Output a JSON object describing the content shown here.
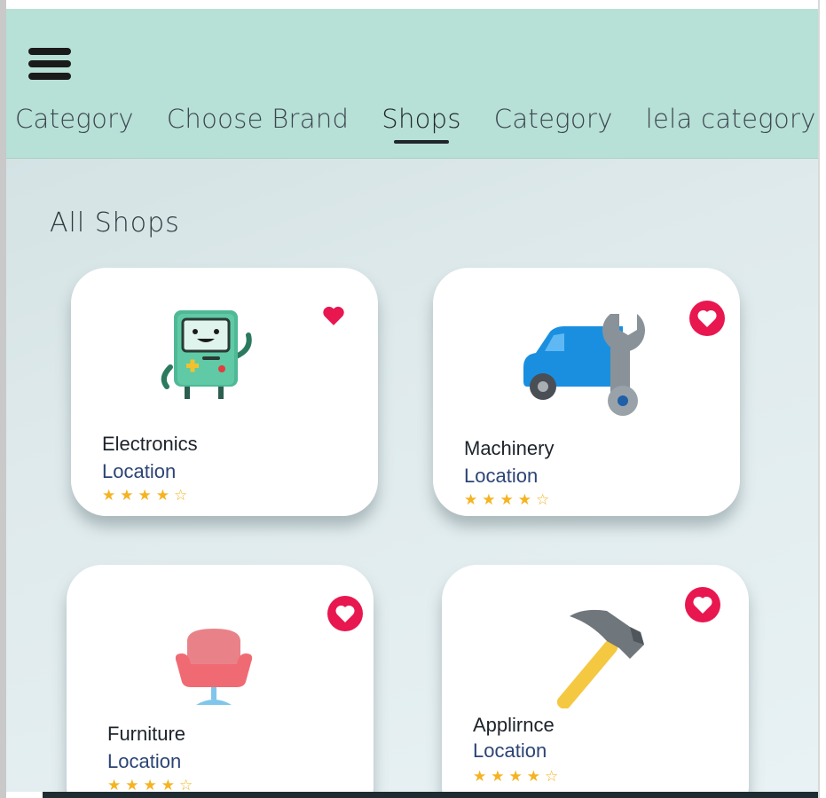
{
  "header": {
    "menu_icon": "hamburger-icon",
    "tabs": [
      {
        "label": "Category"
      },
      {
        "label": "Choose Brand"
      },
      {
        "label": "Shops",
        "active": true
      },
      {
        "label": "Category"
      },
      {
        "label": "lela category"
      }
    ]
  },
  "main": {
    "title": "All Shops",
    "shops": [
      {
        "name": "Electronics",
        "location": "Location",
        "rating": 4,
        "max_rating": 5,
        "favorite": true,
        "icon": "game-console-robot-icon"
      },
      {
        "name": "Machinery",
        "location": "Location",
        "rating": 4,
        "max_rating": 5,
        "favorite": true,
        "icon": "car-wrench-icon"
      },
      {
        "name": "Furniture",
        "location": "Location",
        "rating": 4,
        "max_rating": 5,
        "favorite": true,
        "icon": "armchair-icon"
      },
      {
        "name": "Applirnce",
        "location": "Location",
        "rating": 4,
        "max_rating": 5,
        "favorite": true,
        "icon": "hammer-icon"
      }
    ]
  },
  "colors": {
    "header_bg": "#b7e0d6",
    "heart": "#e8174f",
    "star": "#f5b321",
    "location_text": "#2c4475"
  }
}
